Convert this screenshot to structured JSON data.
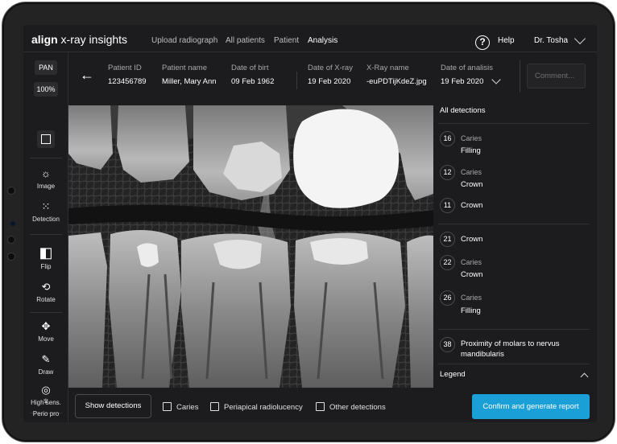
{
  "app": {
    "logo_brand": "align",
    "logo_product": " x-ray insights"
  },
  "nav": {
    "links": [
      "Upload radiograph",
      "All patients",
      "Patient",
      "Analysis"
    ],
    "active_index": 3,
    "help_icon": "?",
    "help_label": "Help",
    "user_name": "Dr. Tosha"
  },
  "toolbar": {
    "view_mode": "PAN",
    "zoom": "100%",
    "tools": [
      {
        "label": "Image",
        "icon": "brightness-icon",
        "glyph": "☼"
      },
      {
        "label": "Detection",
        "icon": "grid-dots-icon",
        "glyph": "⁙"
      },
      {
        "label": "Flip",
        "icon": "flip-icon",
        "glyph": "◧"
      },
      {
        "label": "Rotate",
        "icon": "rotate-icon",
        "glyph": "⟲"
      },
      {
        "label": "Move",
        "icon": "move-icon",
        "glyph": "✥"
      },
      {
        "label": "Draw",
        "icon": "pencil-icon",
        "glyph": "✎"
      },
      {
        "label": "High sens.",
        "icon": "sensitivity-icon",
        "glyph": "◎"
      },
      {
        "label": "Perio pro",
        "icon": "tooth-icon",
        "glyph": "♆"
      }
    ]
  },
  "patient": {
    "id_label": "Patient ID",
    "id": "123456789",
    "name_label": "Patient name",
    "name": "Miller, Mary Ann",
    "dob_label": "Date of birt",
    "dob": "09 Feb 1962",
    "xray_date_label": "Date of X-ray",
    "xray_date": "19 Feb 2020",
    "xray_name_label": "X-Ray name",
    "xray_name": "-euPDTijKdeZ.jpg",
    "analysis_date_label": "Date of analisis",
    "analysis_date": "19 Feb 2020",
    "comment_placeholder": "Comment..."
  },
  "detections": {
    "title": "All detections",
    "items": [
      {
        "tooth": "16",
        "sub": "Caries",
        "main": "Filling"
      },
      {
        "tooth": "12",
        "sub": "Caries",
        "main": "Crown"
      },
      {
        "tooth": "11",
        "sub": "",
        "main": "Crown"
      },
      {
        "tooth": "21",
        "sub": "",
        "main": "Crown"
      },
      {
        "tooth": "22",
        "sub": "Caries",
        "main": "Crown"
      },
      {
        "tooth": "26",
        "sub": "Caries",
        "main": "Filling"
      },
      {
        "tooth": "38",
        "sub": "",
        "main": "Proximity of molars to nervus mandibularis"
      }
    ],
    "legend_label": "Legend"
  },
  "bottom": {
    "show_detections": "Show detections",
    "filters": [
      {
        "label": "Caries",
        "checked": false
      },
      {
        "label": "Periapical radiolucency",
        "checked": false
      },
      {
        "label": "Other detections",
        "checked": false
      }
    ],
    "confirm": "Confirm and generate report"
  },
  "colors": {
    "accent": "#1a9fd6",
    "background": "#1c1c1e",
    "tablet_bezel": "#232323"
  }
}
